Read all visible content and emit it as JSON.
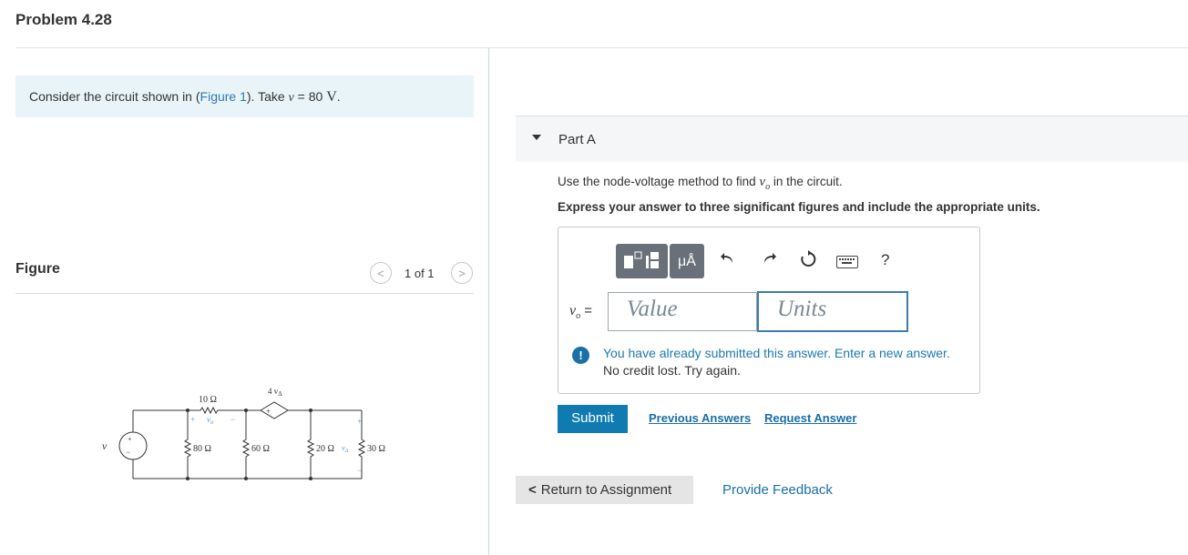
{
  "header": {
    "title": "Problem 4.28"
  },
  "intro": {
    "prefix": "Consider the circuit shown in (",
    "figure_link": "Figure 1",
    "suffix_text": "). Take ",
    "var": "v",
    "equals": " = 80 ",
    "unit": "V",
    "period": "."
  },
  "figure": {
    "label": "Figure",
    "counter": "1 of 1",
    "prev_icon": "chevron-left-icon",
    "next_icon": "chevron-right-icon",
    "circuit": {
      "source_label": "v",
      "r1": "10 Ω",
      "vo_plus": "+",
      "vo_label": "v",
      "vo_sub": "o",
      "vo_minus": "−",
      "dep_source": "4 v",
      "dep_sub": "Δ",
      "r2": "80 Ω",
      "r3": "60 Ω",
      "r4": "20 Ω",
      "r5": "30 Ω",
      "vd_label": "v",
      "vd_sub": "Δ",
      "plus": "+",
      "minus": "−"
    }
  },
  "partA": {
    "title": "Part A",
    "question_prefix": "Use the node-voltage method to find ",
    "question_var": "v",
    "question_sub": "o",
    "question_suffix": " in the circuit.",
    "instructions": "Express your answer to three significant figures and include the appropriate units.",
    "toolbar": {
      "units_label": "μÅ",
      "undo_icon": "undo-icon",
      "redo_icon": "redo-icon",
      "reset_icon": "reset-icon",
      "keyboard_icon": "keyboard-icon",
      "help_label": "?"
    },
    "answer_var": "v",
    "answer_sub": "o",
    "answer_eq": " =",
    "value_placeholder": "Value",
    "units_placeholder": "Units",
    "alert_line1": "You have already submitted this answer. Enter a new answer.",
    "alert_line2": "No credit lost. Try again.",
    "submit_label": "Submit",
    "previous_answers": "Previous Answers",
    "request_answer": "Request Answer"
  },
  "footer": {
    "return_label": "Return to Assignment",
    "feedback_label": "Provide Feedback"
  },
  "colors": {
    "accent": "#0f7bb0",
    "link": "#1a6fa6",
    "intro_bg": "#e8f4f7",
    "toolbar_bg": "#6a7079"
  }
}
